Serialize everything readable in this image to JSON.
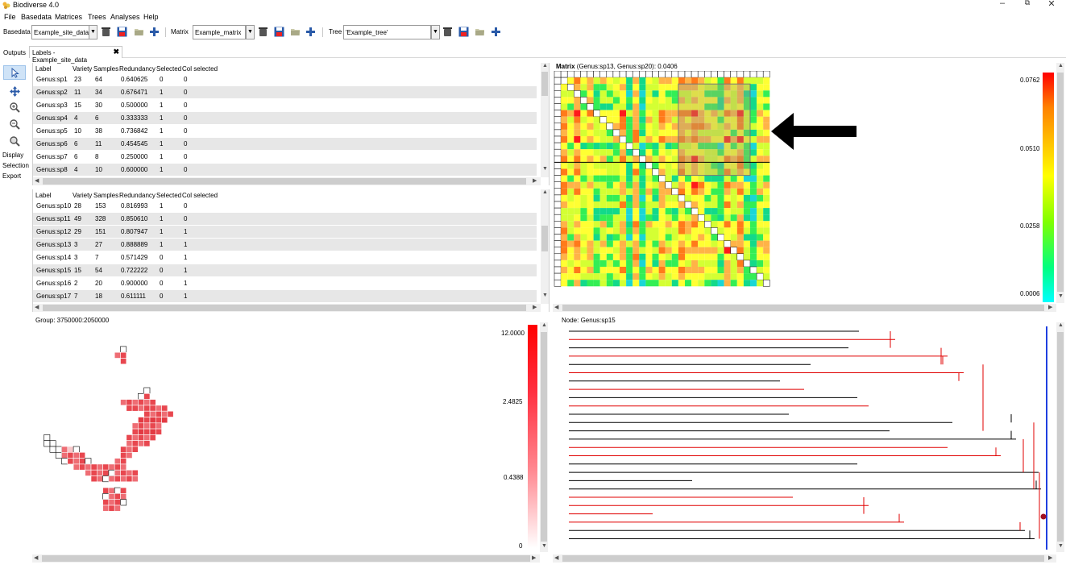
{
  "window": {
    "title": "Biodiverse 4.0",
    "minimize": "–",
    "maximize": "⧉",
    "close": "✕"
  },
  "menu": [
    "File",
    "Basedata",
    "Matrices",
    "Trees",
    "Analyses",
    "Help"
  ],
  "toolbar": {
    "basedata_label": "Basedata",
    "basedata_value": "Example_site_data",
    "matrix_label": "Matrix",
    "matrix_value": "Example_matrix",
    "tree_label": "Tree",
    "tree_value": "'Example_tree'"
  },
  "tabs": [
    {
      "label": "Outputs"
    },
    {
      "label": "Labels - Example_site_data"
    }
  ],
  "tools": {
    "display": "Display",
    "selection": "Selection",
    "export": "Export"
  },
  "table_headers": [
    "Label",
    "Variety",
    "Samples",
    "Redundancy",
    "Selected",
    "Col selected"
  ],
  "table1_rows": [
    [
      "Genus:sp1",
      "23",
      "64",
      "0.640625",
      "0",
      "0"
    ],
    [
      "Genus:sp2",
      "11",
      "34",
      "0.676471",
      "1",
      "0"
    ],
    [
      "Genus:sp3",
      "15",
      "30",
      "0.500000",
      "1",
      "0"
    ],
    [
      "Genus:sp4",
      "4",
      "6",
      "0.333333",
      "1",
      "0"
    ],
    [
      "Genus:sp5",
      "10",
      "38",
      "0.736842",
      "1",
      "0"
    ],
    [
      "Genus:sp6",
      "6",
      "11",
      "0.454545",
      "1",
      "0"
    ],
    [
      "Genus:sp7",
      "6",
      "8",
      "0.250000",
      "1",
      "0"
    ],
    [
      "Genus:sp8",
      "4",
      "10",
      "0.600000",
      "1",
      "0"
    ]
  ],
  "table2_rows": [
    [
      "Genus:sp10",
      "28",
      "153",
      "0.816993",
      "1",
      "0"
    ],
    [
      "Genus:sp11",
      "49",
      "328",
      "0.850610",
      "1",
      "0"
    ],
    [
      "Genus:sp12",
      "29",
      "151",
      "0.807947",
      "1",
      "1"
    ],
    [
      "Genus:sp13",
      "3",
      "27",
      "0.888889",
      "1",
      "1"
    ],
    [
      "Genus:sp14",
      "3",
      "7",
      "0.571429",
      "0",
      "1"
    ],
    [
      "Genus:sp15",
      "15",
      "54",
      "0.722222",
      "0",
      "1"
    ],
    [
      "Genus:sp16",
      "2",
      "20",
      "0.900000",
      "0",
      "1"
    ],
    [
      "Genus:sp17",
      "7",
      "18",
      "0.611111",
      "0",
      "1"
    ]
  ],
  "matrix_panel": {
    "title_bold": "Matrix",
    "title_rest": " (Genus:sp13, Genus:sp20): 0.0406",
    "legend": [
      "0.0762",
      "0.0510",
      "0.0258",
      "0.0006"
    ]
  },
  "map_panel": {
    "caption": "Group: 3750000:2050000",
    "legend": [
      "12.0000",
      "2.4825",
      "0.4388",
      "0"
    ]
  },
  "tree_panel": {
    "caption": "Node: Genus:sp15"
  },
  "colors": {
    "tree_red": "#e00000",
    "tree_black": "#000000",
    "tree_blue": "#1f3fdf",
    "map_red": "#e8474f"
  }
}
